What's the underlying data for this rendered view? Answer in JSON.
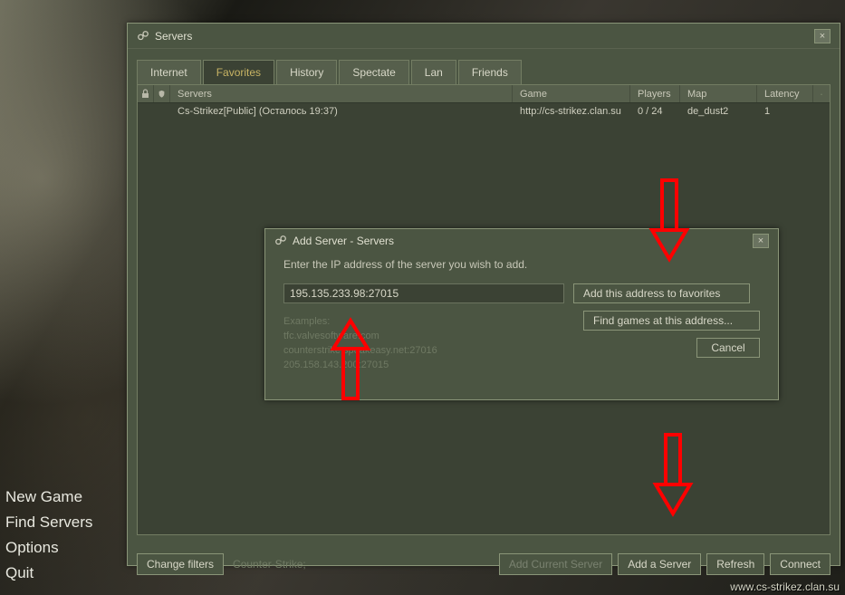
{
  "side_menu": {
    "new_game": "New Game",
    "find_servers": "Find Servers",
    "options": "Options",
    "quit": "Quit"
  },
  "window": {
    "title": "Servers",
    "close": "×"
  },
  "tabs": {
    "internet": "Internet",
    "favorites": "Favorites",
    "history": "History",
    "spectate": "Spectate",
    "lan": "Lan",
    "friends": "Friends"
  },
  "columns": {
    "servers": "Servers",
    "game": "Game",
    "players": "Players",
    "map": "Map",
    "latency": "Latency"
  },
  "rows": [
    {
      "name": "Cs-Strikez[Public] (Осталось 19:37)",
      "game": "http://cs-strikez.clan.su",
      "players": "0 / 24",
      "map": "de_dust2",
      "latency": "1"
    }
  ],
  "bottom": {
    "change_filters": "Change filters",
    "filter_text": "Counter-Strike;",
    "add_current": "Add Current Server",
    "add_server": "Add a Server",
    "refresh": "Refresh",
    "connect": "Connect"
  },
  "dialog": {
    "title": "Add Server - Servers",
    "prompt": "Enter the IP address of the server you wish to add.",
    "input_value": "195.135.233.98:27015",
    "btn_add_fav": "Add this address to favorites",
    "btn_find": "Find games at this address...",
    "btn_cancel": "Cancel",
    "examples_label": "Examples:",
    "ex1": "tfc.valvesoftware.com",
    "ex2": "counterstrike.speakeasy.net:27016",
    "ex3": "205.158.143.200:27015",
    "close": "×"
  },
  "watermark": "www.cs-strikez.clan.su"
}
